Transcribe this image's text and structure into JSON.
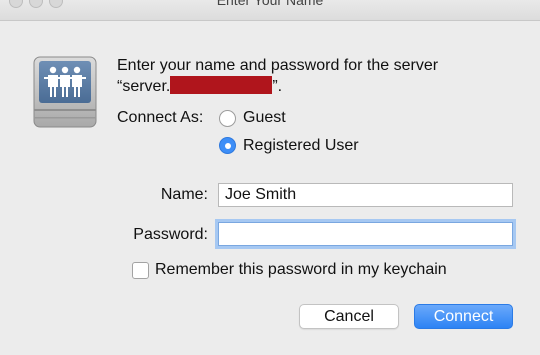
{
  "window": {
    "title": "Enter Your Name"
  },
  "message": {
    "line1": "Enter your name and password for the server",
    "line2_prefix": "“server.",
    "line2_suffix": "”."
  },
  "connect_as": {
    "label": "Connect As:",
    "options": [
      {
        "label": "Guest",
        "selected": false
      },
      {
        "label": "Registered User",
        "selected": true
      }
    ]
  },
  "form": {
    "name_label": "Name:",
    "name_value": "Joe Smith",
    "password_label": "Password:",
    "password_value": ""
  },
  "remember": {
    "label": "Remember this password in my keychain",
    "checked": false
  },
  "buttons": {
    "cancel": "Cancel",
    "connect": "Connect"
  },
  "colors": {
    "accent": "#3d8ef7",
    "redaction": "#b0151c",
    "background": "#ececec"
  },
  "icons": {
    "server": "network-server-icon"
  }
}
